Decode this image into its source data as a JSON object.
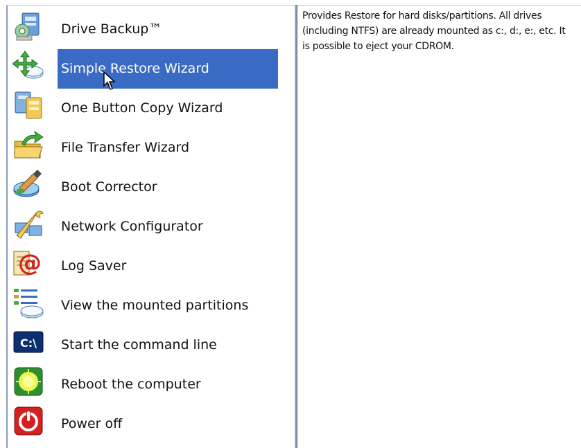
{
  "menu": {
    "selected_index": 1,
    "items": [
      {
        "label": "Drive Backup™",
        "icon": "drive-backup-icon"
      },
      {
        "label": "Simple Restore Wizard",
        "icon": "restore-wizard-icon"
      },
      {
        "label": "One Button Copy Wizard",
        "icon": "copy-wizard-icon"
      },
      {
        "label": "File Transfer Wizard",
        "icon": "file-transfer-icon"
      },
      {
        "label": "Boot Corrector",
        "icon": "boot-corrector-icon"
      },
      {
        "label": "Network Configurator",
        "icon": "network-configurator-icon"
      },
      {
        "label": "Log Saver",
        "icon": "log-saver-icon"
      },
      {
        "label": "View the mounted partitions",
        "icon": "mounted-partitions-icon"
      },
      {
        "label": "Start the command line",
        "icon": "command-line-icon"
      },
      {
        "label": "Reboot the computer",
        "icon": "reboot-icon"
      },
      {
        "label": "Power off",
        "icon": "power-off-icon"
      }
    ]
  },
  "description": {
    "text": "Provides Restore for hard disks/partitions. All drives (including NTFS) are already mounted as c:, d:, e:, etc. It is possible to eject your CDROM."
  },
  "colors": {
    "selection": "#3a6bc4",
    "divider": "#7f92b8"
  }
}
